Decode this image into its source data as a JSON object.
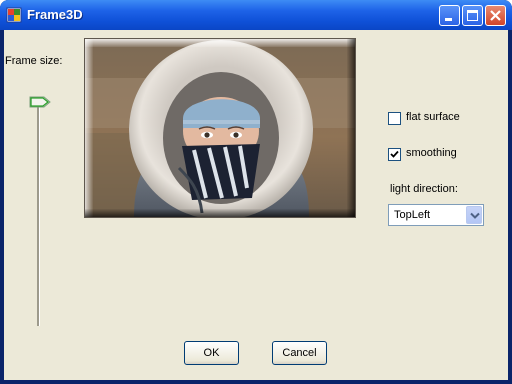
{
  "window": {
    "title": "Frame3D",
    "app_icon": "windows-forms-app-icon",
    "controls": {
      "minimize_icon": "minimize-icon",
      "maximize_icon": "maximize-icon",
      "close_icon": "close-icon"
    }
  },
  "frame_size": {
    "label": "Frame size:",
    "orientation": "vertical",
    "value_fraction": 0.0
  },
  "preview": {
    "description_icon": "photo-preview",
    "effect": "3D raised frame"
  },
  "options": {
    "flat_surface": {
      "label": "flat surface",
      "checked": false
    },
    "smoothing": {
      "label": "smoothing",
      "checked": true
    }
  },
  "light_direction": {
    "label": "light direction:",
    "selected": "TopLeft"
  },
  "buttons": {
    "ok": "OK",
    "cancel": "Cancel"
  },
  "colors": {
    "titlebar": "#0a46c6",
    "client_bg": "#ece9d8",
    "close_button": "#d1452a",
    "button_border": "#003c74"
  }
}
